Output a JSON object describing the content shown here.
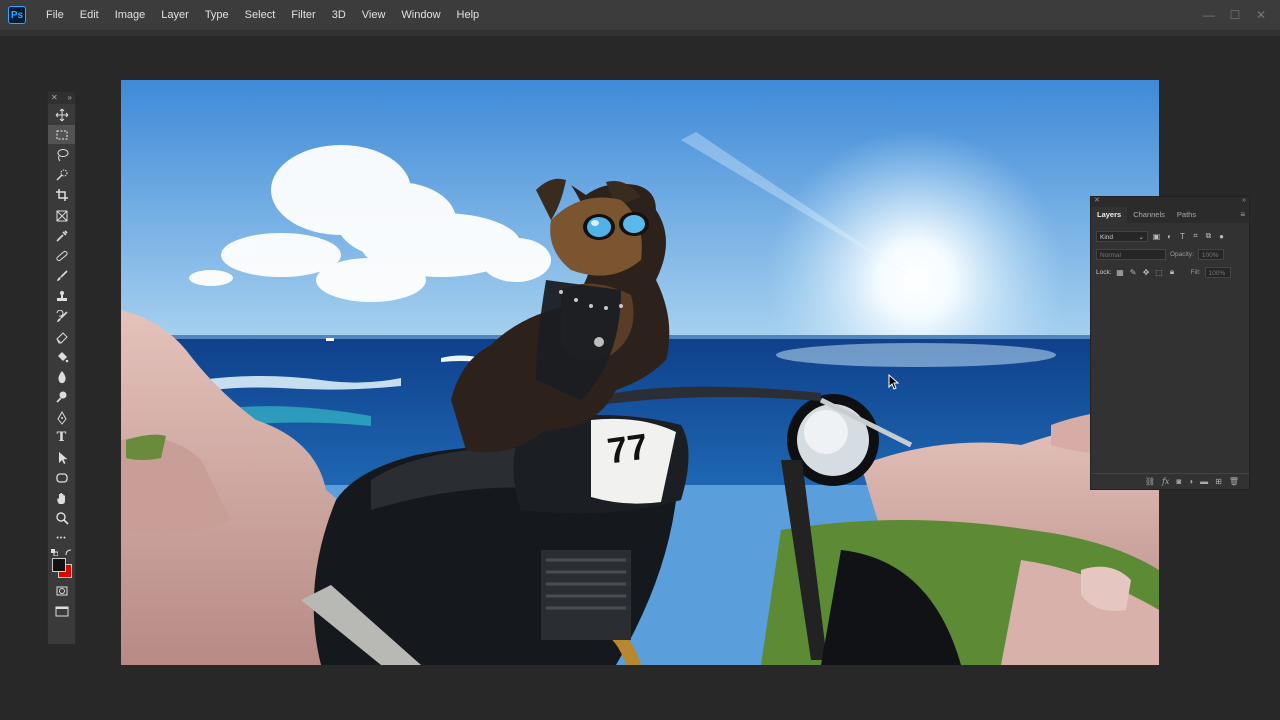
{
  "app": {
    "logo": "Ps",
    "brand_color": "#31a8ff"
  },
  "menu": [
    "File",
    "Edit",
    "Image",
    "Layer",
    "Type",
    "Select",
    "Filter",
    "3D",
    "View",
    "Window",
    "Help"
  ],
  "window_controls": {
    "minimize": "—",
    "maximize": "☐",
    "close": "✕"
  },
  "toolbar": {
    "collapse": "✕",
    "expand": "»",
    "tools": [
      "move-tool",
      "marquee-tool",
      "lasso-tool",
      "quick-select-tool",
      "crop-tool",
      "frame-tool",
      "eyedropper-tool",
      "healing-brush-tool",
      "brush-tool",
      "clone-stamp-tool",
      "history-brush-tool",
      "eraser-tool",
      "paint-bucket-tool",
      "blur-tool",
      "dodge-tool",
      "pen-tool",
      "type-tool",
      "path-select-tool",
      "shape-tool",
      "hand-tool",
      "zoom-tool",
      "more-tools"
    ],
    "type_glyph": "T",
    "more_glyph": "•••",
    "foreground_color": "#111111",
    "background_color": "#e00000"
  },
  "layers_panel": {
    "tabs": [
      "Layers",
      "Channels",
      "Paths"
    ],
    "active_tab": "Layers",
    "filter_label": "Kind",
    "blend_mode": "Normal",
    "opacity_label": "Opacity:",
    "opacity_value": "100%",
    "lock_label": "Lock:",
    "fill_label": "Fill:",
    "fill_value": "100%"
  }
}
